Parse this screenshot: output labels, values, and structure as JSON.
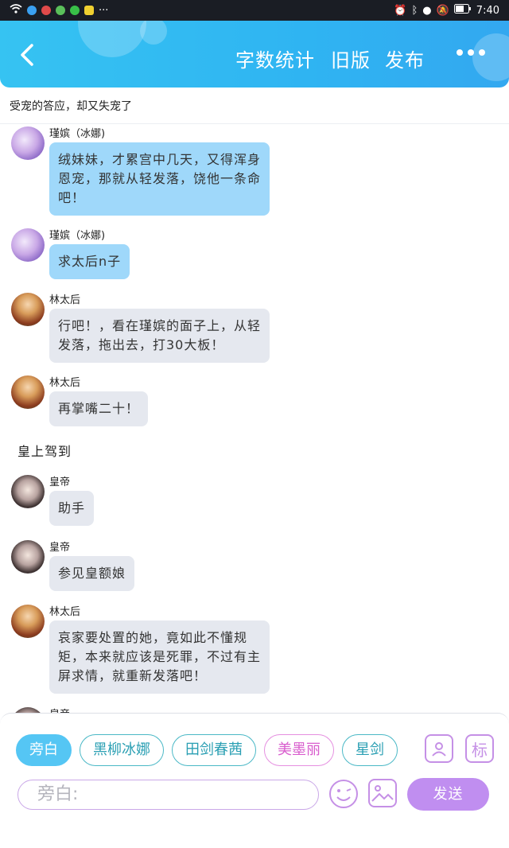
{
  "status_bar": {
    "time": "7:40"
  },
  "header": {
    "word_count": "字数统计",
    "old_version": "旧版",
    "publish": "发布"
  },
  "story": {
    "title": "受宠的答应，却又失宠了"
  },
  "messages": [
    {
      "sender": "瑾嫔（冰娜)",
      "text": "绒妹妹，才累宫中几天，又得浑身恩宠，那就从轻发落，饶他一条命吧！",
      "line1": "绒妹妹，才累宫中几天，又得浑身",
      "line2": "恩宠，那就从轻发落，饶他一条命",
      "line3": "吧！"
    },
    {
      "sender": "瑾嫔（冰娜)",
      "text": "求太后n子"
    },
    {
      "sender": "林太后",
      "line1": "行吧！，看在瑾嫔的面子上，从轻",
      "line2": "发落，拖出去，打30大板！"
    },
    {
      "sender": "林太后",
      "text": "再掌嘴二十！"
    },
    {
      "narration": "皇上驾到"
    },
    {
      "sender": "皇帝",
      "text": "助手"
    },
    {
      "sender": "皇帝",
      "text": "参见皇额娘"
    },
    {
      "sender": "林太后",
      "line1": "哀家要处置的她，竟如此不懂规",
      "line2": "矩，本来就应该是死罪，不过有主",
      "line3": "屏求情，就重新发落吧！"
    },
    {
      "sender": "皇帝"
    }
  ],
  "roles": [
    "旁白",
    "黑柳冰娜",
    "田剑春茜",
    "美墨丽",
    "星剑"
  ],
  "panel": {
    "mark_label": "标",
    "input_placeholder": "旁白:",
    "send_label": "发送"
  }
}
